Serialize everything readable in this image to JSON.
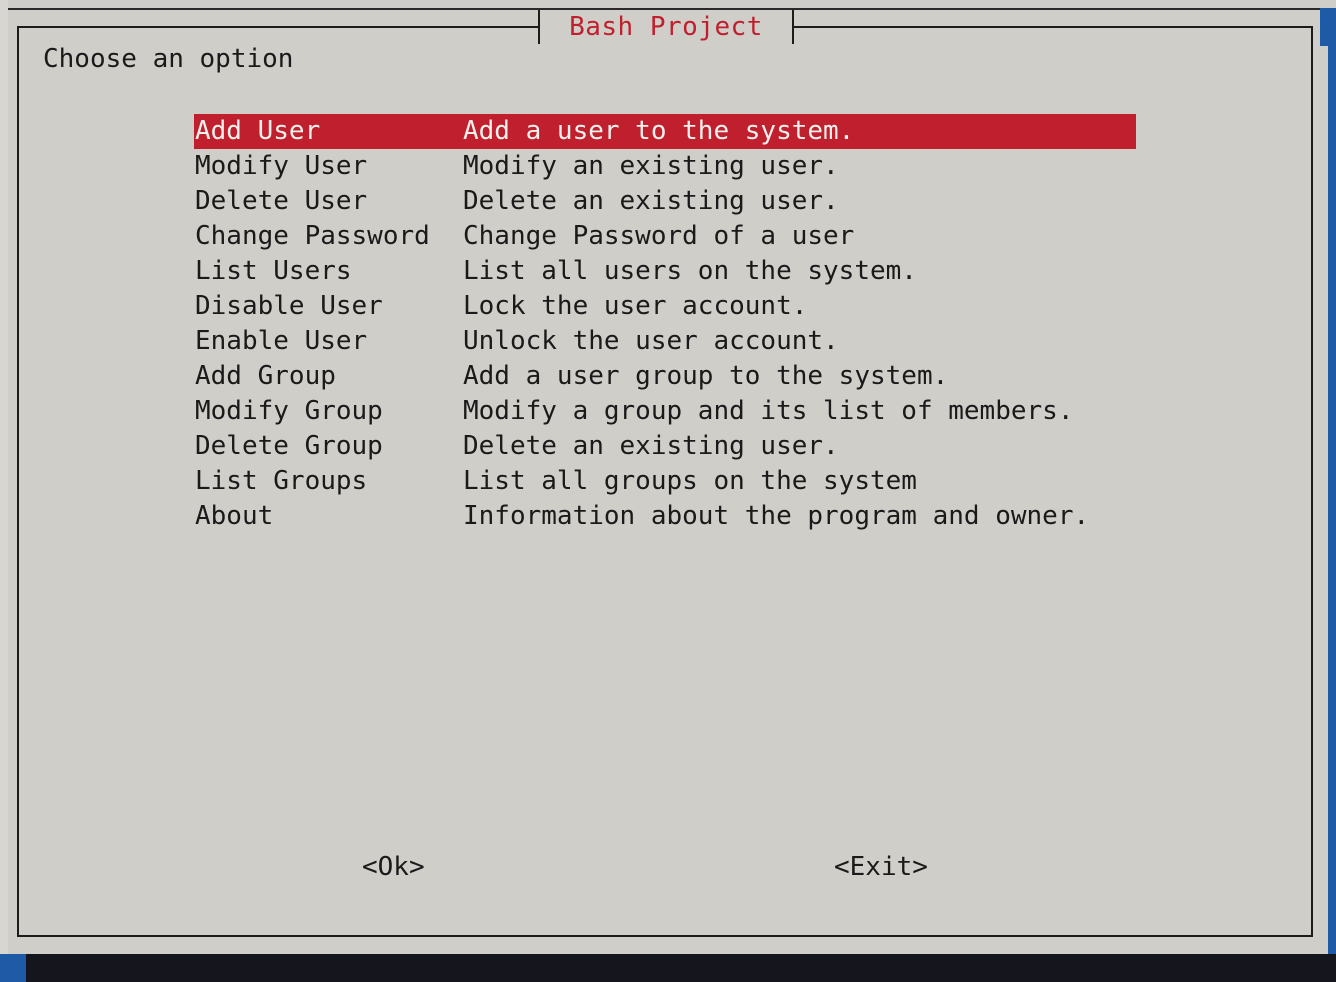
{
  "dialog": {
    "title": "Bash Project",
    "prompt": "Choose an option"
  },
  "menu": {
    "selected_index": 0,
    "items": [
      {
        "tag": "Add User",
        "description": "Add a user to the system."
      },
      {
        "tag": "Modify User",
        "description": "Modify an existing user."
      },
      {
        "tag": "Delete User",
        "description": "Delete an existing user."
      },
      {
        "tag": "Change Password",
        "description": "Change Password of a user"
      },
      {
        "tag": "List Users",
        "description": "List all users on the system."
      },
      {
        "tag": "Disable User",
        "description": "Lock the user account."
      },
      {
        "tag": "Enable User",
        "description": "Unlock the user account."
      },
      {
        "tag": "Add Group",
        "description": "Add a user group to the system."
      },
      {
        "tag": "Modify Group",
        "description": "Modify a group and its list of members."
      },
      {
        "tag": "Delete Group",
        "description": "Delete an existing user."
      },
      {
        "tag": "List Groups",
        "description": "List all groups on the system"
      },
      {
        "tag": "About",
        "description": "Information about the program and owner."
      }
    ]
  },
  "buttons": {
    "ok_label": "<Ok>",
    "exit_label": "<Exit>"
  },
  "colors": {
    "background": "#d0cec9",
    "accent": "#c01f2d",
    "frame": "#1c1c1c",
    "terminal_blue": "#1f5aa6"
  }
}
